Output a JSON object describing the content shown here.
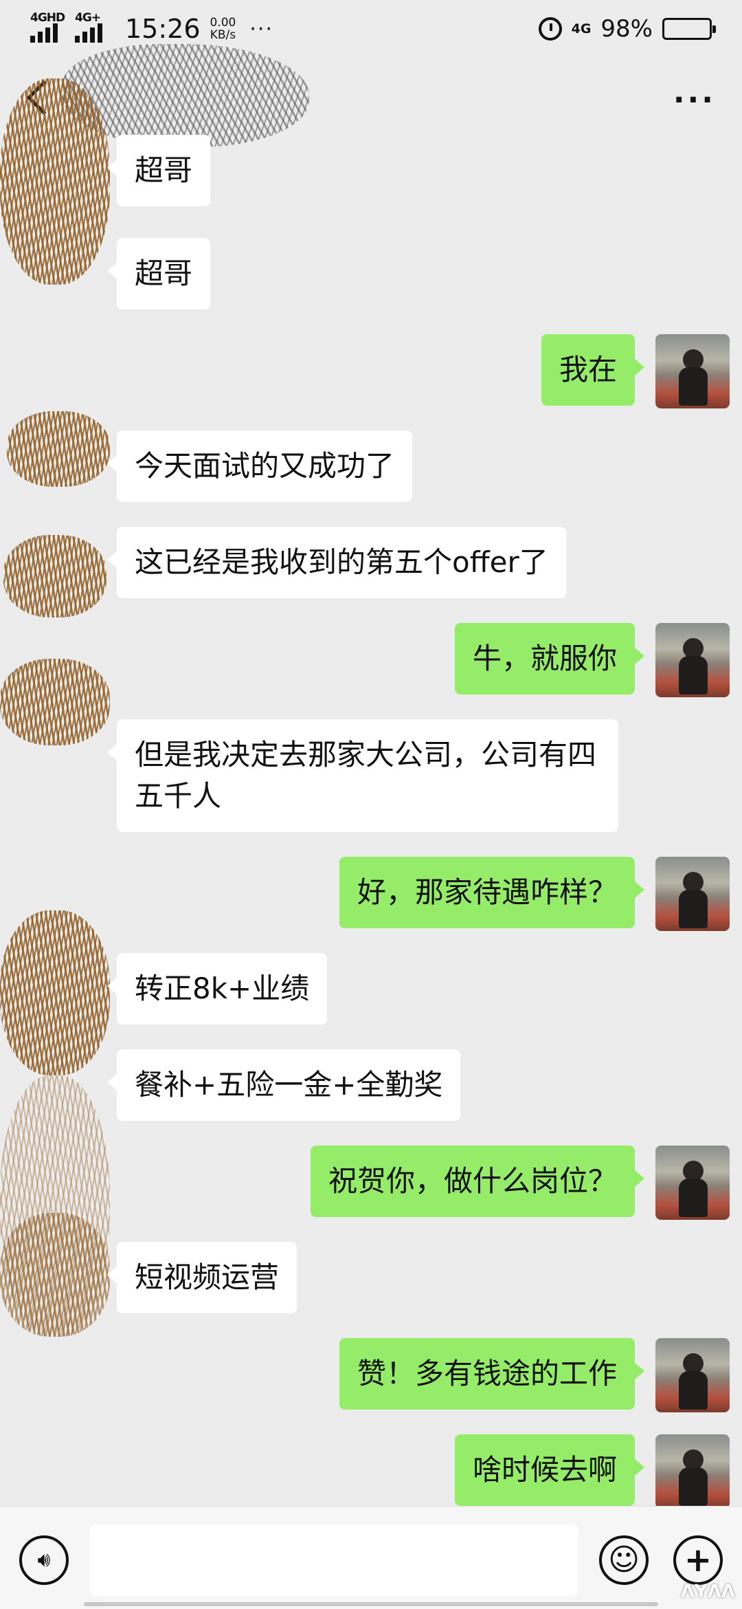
{
  "status_bar": {
    "signal1_label": "4GHD",
    "signal2_label": "4G+",
    "time": "15:26",
    "net_speed_value": "0.00",
    "net_speed_unit": "KB/s",
    "more": "···",
    "net_type": "4G",
    "battery_pct": "98%",
    "battery_level": 0.98
  },
  "nav": {
    "more_icon": "···"
  },
  "messages": [
    {
      "side": "recv",
      "text": "超哥"
    },
    {
      "side": "recv",
      "text": "超哥"
    },
    {
      "side": "sent",
      "text": "我在"
    },
    {
      "side": "recv",
      "text": "今天面试的又成功了"
    },
    {
      "side": "recv",
      "text": "这已经是我收到的第五个offer了"
    },
    {
      "side": "sent",
      "text": "牛，就服你"
    },
    {
      "side": "recv",
      "text": "但是我决定去那家大公司，公司有四五千人"
    },
    {
      "side": "sent",
      "text": "好，那家待遇咋样？"
    },
    {
      "side": "recv",
      "text": "转正8k+业绩"
    },
    {
      "side": "recv",
      "text": "餐补+五险一金+全勤奖"
    },
    {
      "side": "sent",
      "text": "祝贺你，做什么岗位？"
    },
    {
      "side": "recv",
      "text": "短视频运营"
    },
    {
      "side": "sent",
      "text": "赞！多有钱途的工作"
    },
    {
      "side": "sent",
      "text": "啥时候去啊"
    }
  ],
  "input_bar": {
    "voice_icon": "voice-icon",
    "emoji_icon": "emoji-icon",
    "plus_icon": "plus-icon",
    "input_value": ""
  },
  "watermark": "ΛΥΛΛ"
}
